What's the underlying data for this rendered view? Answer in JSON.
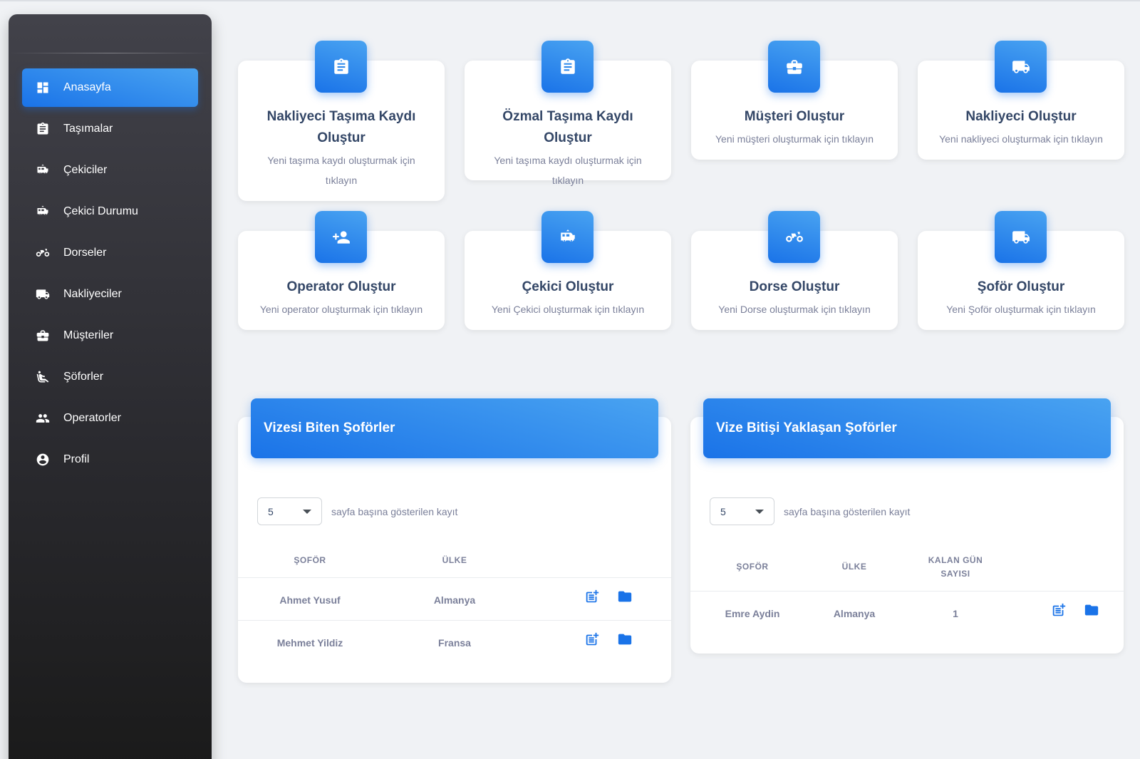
{
  "sidebar": {
    "items": [
      {
        "label": "Anasayfa",
        "icon": "dashboard-icon",
        "active": true
      },
      {
        "label": "Taşımalar",
        "icon": "clipboard-icon"
      },
      {
        "label": "Çekiciler",
        "icon": "rv-truck-icon"
      },
      {
        "label": "Çekici Durumu",
        "icon": "rv-truck-icon"
      },
      {
        "label": "Dorseler",
        "icon": "trailer-icon"
      },
      {
        "label": "Nakliyeciler",
        "icon": "truck-icon"
      },
      {
        "label": "Müşteriler",
        "icon": "briefcase-icon"
      },
      {
        "label": "Şöforler",
        "icon": "seat-icon"
      },
      {
        "label": "Operatorler",
        "icon": "people-icon"
      },
      {
        "label": "Profil",
        "icon": "account-circle-icon"
      }
    ]
  },
  "cards": [
    {
      "title": "Nakliyeci Taşıma Kaydı Oluştur",
      "subtitle": "Yeni taşıma kaydı oluşturmak için tıklayın",
      "icon": "clipboard-icon"
    },
    {
      "title": "Özmal Taşıma Kaydı Oluştur",
      "subtitle": "Yeni taşıma kaydı oluşturmak için tıklayın",
      "icon": "clipboard-icon"
    },
    {
      "title": "Müşteri Oluştur",
      "subtitle": "Yeni müşteri oluşturmak için tıklayın",
      "icon": "briefcase-icon"
    },
    {
      "title": "Nakliyeci Oluştur",
      "subtitle": "Yeni nakliyeci oluşturmak için tıklayın",
      "icon": "truck-icon"
    },
    {
      "title": "Operator Oluştur",
      "subtitle": "Yeni operator oluşturmak için tıklayın",
      "icon": "person-add-icon"
    },
    {
      "title": "Çekici Oluştur",
      "subtitle": "Yeni Çekici oluşturmak için tıklayın",
      "icon": "rv-truck-icon"
    },
    {
      "title": "Dorse Oluştur",
      "subtitle": "Yeni Dorse oluşturmak için tıklayın",
      "icon": "trailer-icon"
    },
    {
      "title": "Şoför Oluştur",
      "subtitle": "Yeni Şoför oluşturmak için tıklayın",
      "icon": "truck-icon"
    }
  ],
  "expired_table": {
    "title": "Vizesi Biten Şoförler",
    "per_page_value": "5",
    "per_page_label": "sayfa başına gösterilen kayıt",
    "columns": [
      "ŞOFÖR",
      "ÜLKE"
    ],
    "rows": [
      {
        "driver": "Ahmet Yusuf",
        "country": "Almanya"
      },
      {
        "driver": "Mehmet Yildiz",
        "country": "Fransa"
      }
    ]
  },
  "upcoming_table": {
    "title": "Vize Bitişi Yaklaşan Şoförler",
    "per_page_value": "5",
    "per_page_label": "sayfa başına gösterilen kayıt",
    "columns": [
      "ŞOFÖR",
      "ÜLKE",
      "KALAN GÜN SAYISI"
    ],
    "rows": [
      {
        "driver": "Emre Aydin",
        "country": "Almanya",
        "days_left": "1"
      }
    ]
  }
}
